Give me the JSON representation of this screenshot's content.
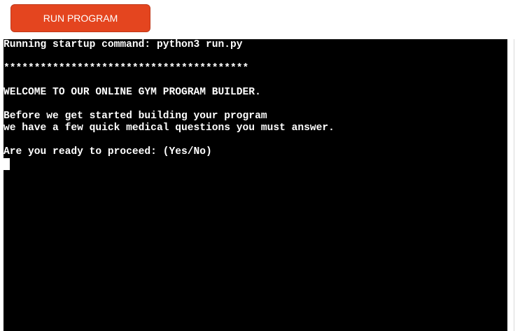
{
  "toolbar": {
    "run_label": "RUN PROGRAM"
  },
  "terminal": {
    "lines": [
      "Running startup command: python3 run.py",
      "",
      "****************************************",
      "",
      "WELCOME TO OUR ONLINE GYM PROGRAM BUILDER.",
      "",
      "Before we get started building your program",
      "we have a few quick medical questions you must answer.",
      "",
      "Are you ready to proceed: (Yes/No)"
    ]
  },
  "colors": {
    "button_bg": "#e4451f",
    "terminal_bg": "#000000",
    "terminal_fg": "#ffffff"
  }
}
